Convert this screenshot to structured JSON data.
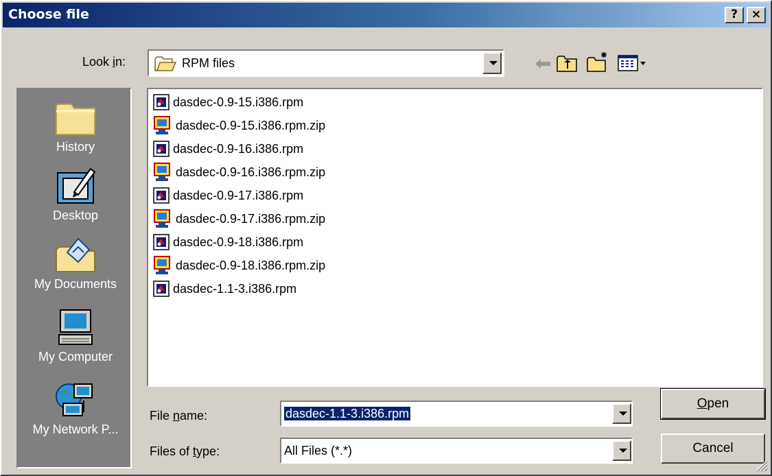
{
  "window": {
    "title": "Choose file",
    "help_glyph": "?",
    "close_glyph": "×"
  },
  "look_in": {
    "label_pre": "Look ",
    "label_access": "i",
    "label_post": "n:",
    "value": "RPM files",
    "icon": "folder-open-icon"
  },
  "toolbar": {
    "back_icon": "back-arrow-icon",
    "up_icon": "up-folder-icon",
    "new_folder_icon": "new-folder-icon",
    "view_menu_icon": "view-menu-icon"
  },
  "places": [
    {
      "label": "History",
      "icon": "history-folder-icon"
    },
    {
      "label": "Desktop",
      "icon": "desktop-icon"
    },
    {
      "label": "My Documents",
      "icon": "my-documents-icon"
    },
    {
      "label": "My Computer",
      "icon": "my-computer-icon"
    },
    {
      "label": "My Network P...",
      "icon": "my-network-places-icon"
    }
  ],
  "files": [
    {
      "name": "dasdec-0.9-15.i386.rpm",
      "type": "rpm"
    },
    {
      "name": "dasdec-0.9-15.i386.rpm.zip",
      "type": "zip"
    },
    {
      "name": "dasdec-0.9-16.i386.rpm",
      "type": "rpm"
    },
    {
      "name": "dasdec-0.9-16.i386.rpm.zip",
      "type": "zip"
    },
    {
      "name": "dasdec-0.9-17.i386.rpm",
      "type": "rpm"
    },
    {
      "name": "dasdec-0.9-17.i386.rpm.zip",
      "type": "zip"
    },
    {
      "name": "dasdec-0.9-18.i386.rpm",
      "type": "rpm"
    },
    {
      "name": "dasdec-0.9-18.i386.rpm.zip",
      "type": "zip"
    },
    {
      "name": "dasdec-1.1-3.i386.rpm",
      "type": "rpm"
    }
  ],
  "file_name": {
    "label_pre": "File ",
    "label_access": "n",
    "label_post": "ame:",
    "value": "dasdec-1.1-3.i386.rpm"
  },
  "file_type": {
    "label_pre": "Files of ",
    "label_access": "t",
    "label_post": "ype:",
    "value": "All Files (*.*)"
  },
  "buttons": {
    "open_access": "O",
    "open_rest": "pen",
    "cancel": "Cancel"
  },
  "colors": {
    "title_start": "#0a246a",
    "title_end": "#a6caf0",
    "face": "#d4d0c8",
    "places_bg": "#808080",
    "selection": "#0a246a"
  }
}
